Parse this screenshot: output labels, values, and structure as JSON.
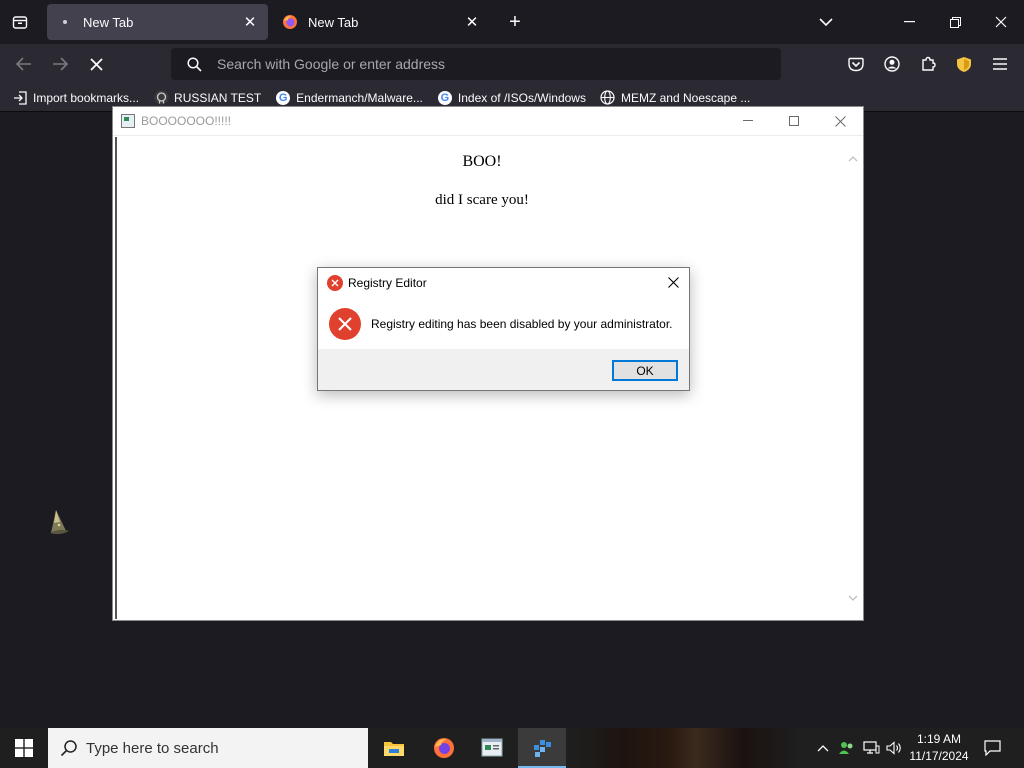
{
  "browser": {
    "tabs": [
      {
        "label": "New Tab",
        "active": true
      },
      {
        "label": "New Tab",
        "active": false
      }
    ],
    "url_placeholder": "Search with Google or enter address",
    "bookmarks": [
      {
        "label": "Import bookmarks...",
        "icon": "import-icon"
      },
      {
        "label": "RUSSIAN TEST",
        "icon": "github-icon"
      },
      {
        "label": "Endermanch/Malware...",
        "icon": "google-icon"
      },
      {
        "label": "Index of /ISOs/Windows",
        "icon": "google-icon"
      },
      {
        "label": "MEMZ and Noescape ...",
        "icon": "globe-icon"
      }
    ],
    "google_glyph": "G"
  },
  "hta_window": {
    "title": "BOOOOOOO!!!!!",
    "line1": "BOO!",
    "line2": "did I scare you!"
  },
  "dialog": {
    "title": "Registry Editor",
    "message": "Registry editing has been disabled by your administrator.",
    "ok_label": "OK"
  },
  "taskbar": {
    "search_placeholder": "Type here to search",
    "time": "1:19 AM",
    "date": "11/17/2024"
  },
  "colors": {
    "accent": "#0078d7",
    "error": "#e0412f",
    "chrome_dark": "#1c1b22",
    "toolbar": "#2b2a33"
  }
}
